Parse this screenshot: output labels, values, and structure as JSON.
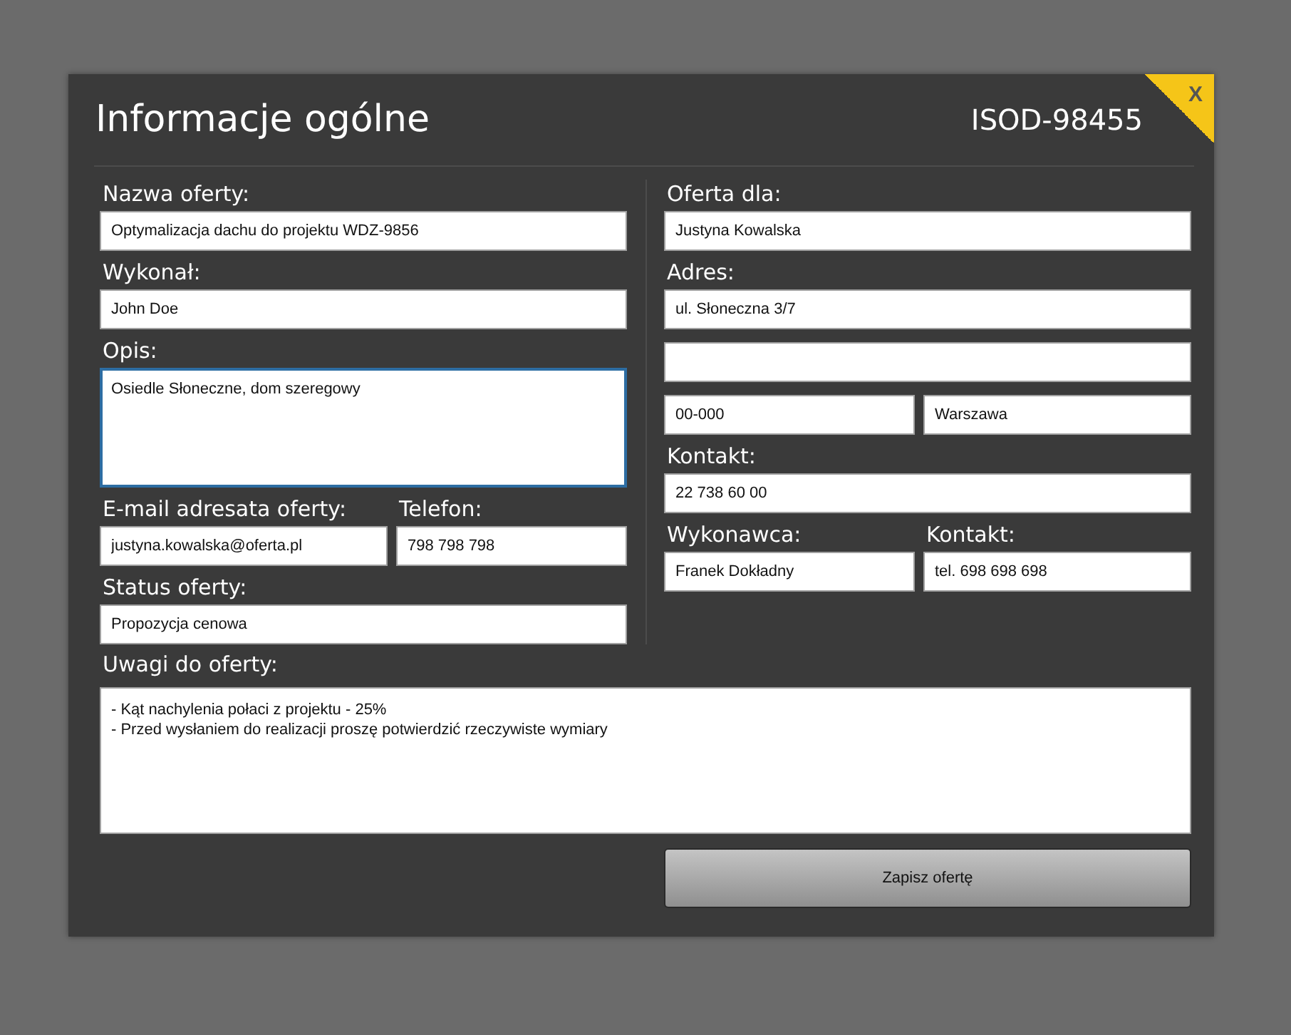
{
  "dialog": {
    "title": "Informacje ogólne",
    "number": "ISOD-98455",
    "close": "X"
  },
  "left_column": [
    {
      "fields": [
        {
          "label": "Nazwa oferty:",
          "value": "Optymalizacja dachu do projektu WDZ-9856",
          "kind": "input",
          "focused": false
        }
      ]
    },
    {
      "fields": [
        {
          "label": "Wykonał:",
          "value": "John Doe",
          "kind": "input",
          "focused": false
        }
      ]
    },
    {
      "fields": [
        {
          "label": "Opis:",
          "value": "Osiedle Słoneczne, dom szeregowy",
          "kind": "textarea",
          "focused": true
        }
      ]
    },
    {
      "fields": [
        {
          "label": "E-mail adresata oferty:",
          "value": "justyna.kowalska@oferta.pl",
          "kind": "input",
          "focused": false
        },
        {
          "label": "Telefon:",
          "value": "798 798 798",
          "kind": "input",
          "focused": false
        }
      ]
    },
    {
      "fields": [
        {
          "label": "Status oferty:",
          "value": "Propozycja cenowa",
          "kind": "input",
          "focused": false
        }
      ]
    }
  ],
  "right_column": [
    {
      "fields": [
        {
          "label": "Oferta dla:",
          "value": "Justyna Kowalska",
          "kind": "input",
          "focused": false
        }
      ]
    },
    {
      "fields": [
        {
          "label": "Adres:",
          "value": "ul. Słoneczna 3/7",
          "kind": "input",
          "focused": false
        }
      ]
    },
    {
      "fields": [
        {
          "kind": "input",
          "focused": false
        }
      ]
    },
    {
      "fields": [
        {
          "value": "00-000",
          "kind": "input",
          "focused": false
        },
        {
          "value": "Warszawa",
          "kind": "input",
          "focused": false
        }
      ]
    },
    {
      "fields": [
        {
          "label": "Kontakt:",
          "value": "22 738 60 00",
          "kind": "input",
          "focused": false
        }
      ]
    },
    {
      "fields": [
        {
          "label": "Wykonawca:",
          "value": "Franek Dokładny",
          "kind": "input",
          "focused": false
        },
        {
          "label": "Kontakt:",
          "value": "tel. 698 698 698",
          "kind": "input",
          "focused": false
        }
      ]
    }
  ],
  "notes": {
    "label": "Uwagi do oferty:",
    "lines": [
      "- Kąt nachylenia połaci z projektu - 25%",
      "- Przed wysłaniem do realizacji proszę potwierdzić rzeczywiste wymiary"
    ]
  },
  "save_button": "Zapisz ofertę"
}
